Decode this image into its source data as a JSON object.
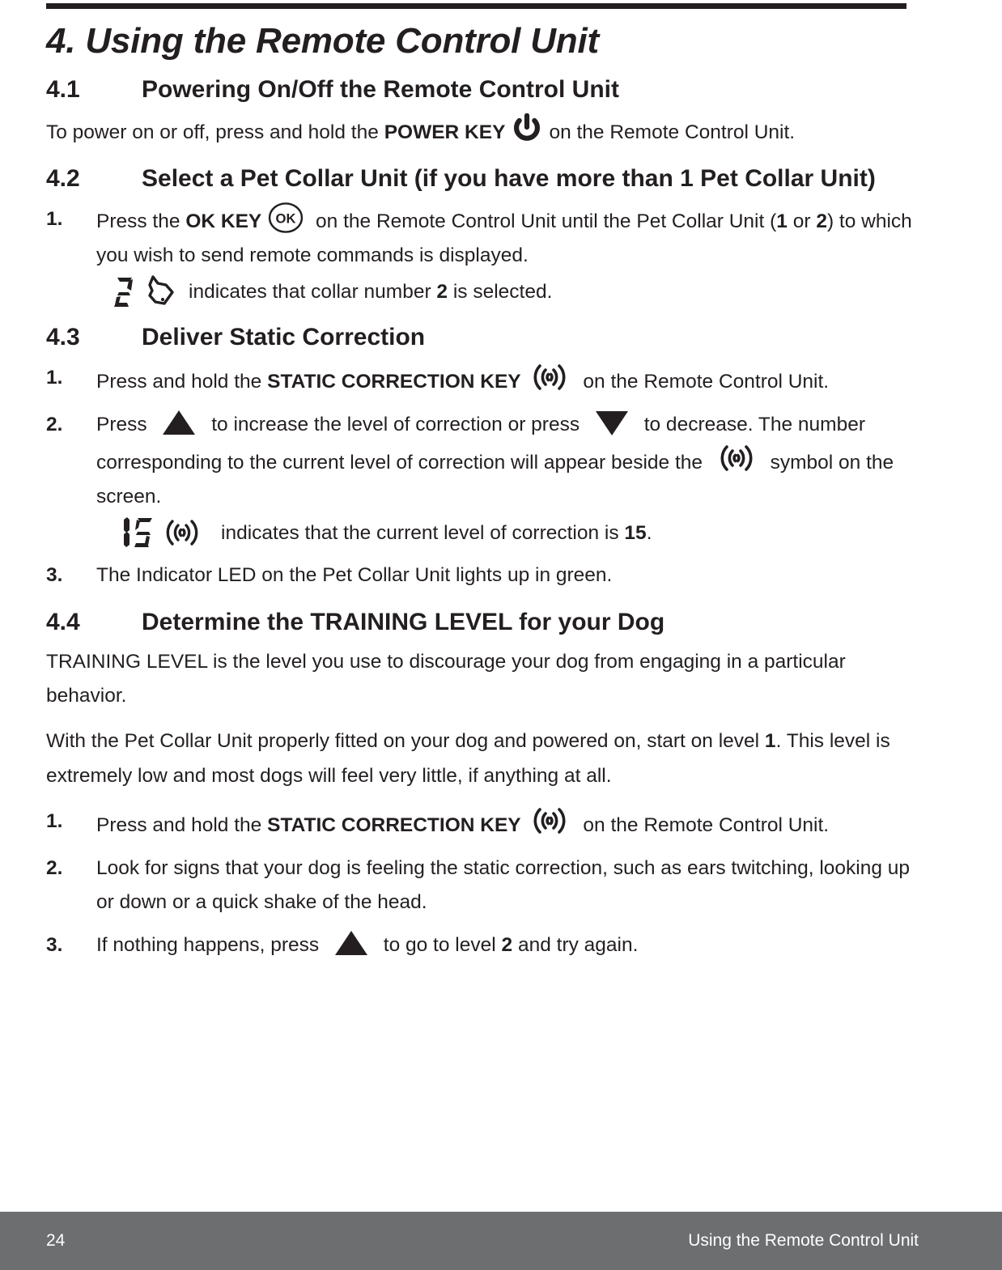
{
  "document": {
    "chapter_title": "4. Using the Remote Control Unit",
    "sections": [
      {
        "number": "4.1",
        "title": "Powering On/Off the Remote Control Unit",
        "paragraph_pre": "To power on or off, press and hold the ",
        "key_label": "POWER KEY",
        "paragraph_post": "on the Remote Control Unit.",
        "icon": "power-icon"
      },
      {
        "number": "4.2",
        "title": "Select a Pet Collar Unit (if you have more than 1 Pet Collar Unit)",
        "step1_num": "1.",
        "step1_a": "Press the ",
        "step1_key": "OK KEY",
        "step1_b": " on the Remote Control Unit until the Pet Collar Unit (",
        "step1_c": "1",
        "step1_d": " or ",
        "step1_e": "2",
        "step1_f": ") to which you wish to send remote commands is displayed.",
        "lcd_value": "2",
        "lcd_note_a": "indicates that collar number ",
        "lcd_note_b": "2",
        "lcd_note_c": " is selected.",
        "icon_key": "ok-key-icon",
        "icon_lcd": "dog-head-icon"
      },
      {
        "number": "4.3",
        "title": "Deliver Static Correction",
        "steps": [
          {
            "num": "1.",
            "a": "Press and hold the ",
            "key": "STATIC CORRECTION KEY",
            "b": " on the Remote Control Unit.",
            "icon": "static-correction-icon"
          },
          {
            "num": "2.",
            "a": "Press ",
            "b": " to increase the level of correction or press ",
            "c": " to decrease. The number corresponding to the current level of correction will appear beside the ",
            "d": " symbol on the screen.",
            "icon_up": "triangle-up-icon",
            "icon_down": "triangle-down-icon",
            "icon_signal": "static-correction-icon",
            "lcd_value": "15",
            "lcd_note_a": "indicates that the current level of correction is ",
            "lcd_note_b": "15",
            "lcd_note_c": "."
          },
          {
            "num": "3.",
            "a": "The Indicator LED on the Pet Collar Unit lights up in green."
          }
        ]
      },
      {
        "number": "4.4",
        "title": "Determine the TRAINING LEVEL for your Dog",
        "para1": "TRAINING LEVEL is the level you use to discourage your dog from engaging in a particular behavior.",
        "para2_a": "With the Pet Collar Unit properly fitted on your dog and powered on, start on level ",
        "para2_b": "1",
        "para2_c": ". This level is extremely low and most dogs will feel very little, if anything at all.",
        "steps": [
          {
            "num": "1.",
            "a": "Press and hold the ",
            "key": "STATIC CORRECTION KEY",
            "b": " on the Remote Control Unit.",
            "icon": "static-correction-icon"
          },
          {
            "num": "2.",
            "a": "Look for signs that your dog is feeling the static correction, such as ears twitching, looking up or down or a quick shake of the head."
          },
          {
            "num": "3.",
            "a": "If nothing happens, press ",
            "b": " to go to level ",
            "c": "2",
            "d": " and try again.",
            "icon_up": "triangle-up-icon"
          }
        ]
      }
    ]
  },
  "footer": {
    "page_number": "24",
    "section_label": "Using the Remote Control Unit"
  },
  "colors": {
    "text": "#231f20",
    "footer_bg": "#6d6e70",
    "footer_text": "#ffffff"
  }
}
